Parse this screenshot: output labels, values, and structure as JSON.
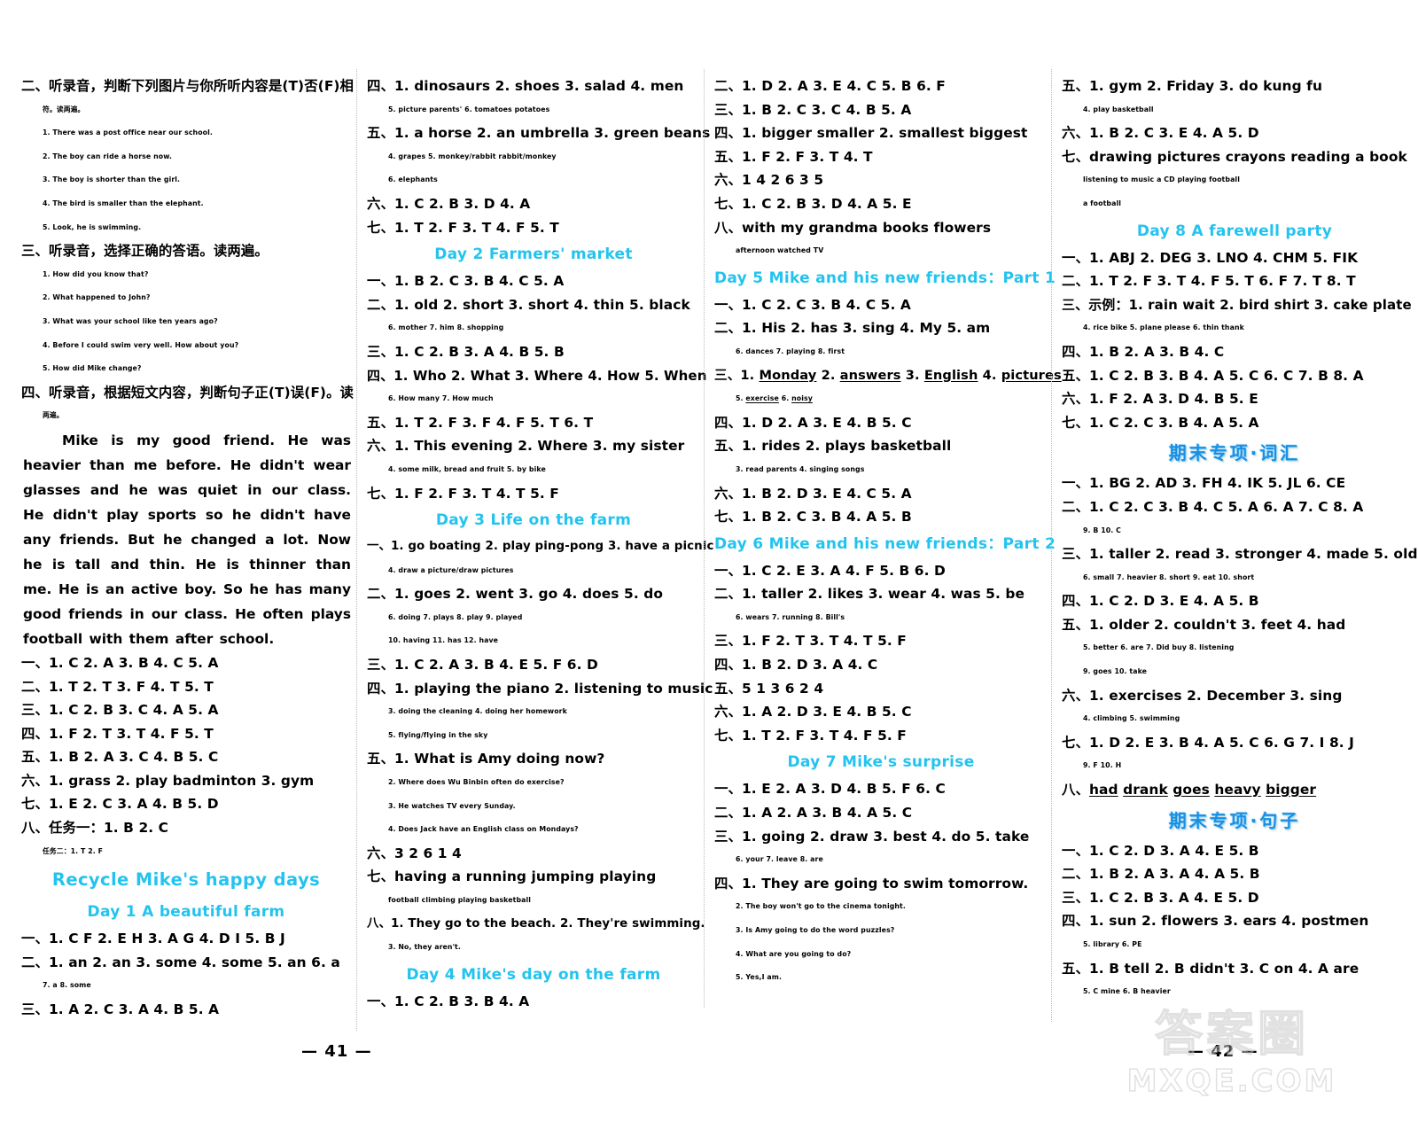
{
  "document": {
    "page_numbers": {
      "left": "— 41 —",
      "right": "— 42 —"
    },
    "watermark": {
      "chinese": "答案圈",
      "english": "MXQE.COM"
    }
  },
  "column1": {
    "blocks": [
      {
        "type": "line",
        "text": "二、听录音，判断下列图片与你所听内容是(T)否(F)相"
      },
      {
        "type": "line",
        "indent": 1,
        "text": "符。读两遍。"
      },
      {
        "type": "line",
        "indent": 1,
        "text": "1. There was a post office near our school."
      },
      {
        "type": "line",
        "indent": 1,
        "text": "2. The boy can ride a horse now."
      },
      {
        "type": "line",
        "indent": 1,
        "text": "3. The boy is shorter than the girl."
      },
      {
        "type": "line",
        "indent": 1,
        "text": "4. The bird is smaller than the elephant."
      },
      {
        "type": "line",
        "indent": 1,
        "text": "5. Look, he is swimming."
      },
      {
        "type": "line",
        "text": "三、听录音，选择正确的答语。读两遍。"
      },
      {
        "type": "line",
        "indent": 1,
        "text": "1. How did you know that?"
      },
      {
        "type": "line",
        "indent": 1,
        "text": "2. What happened to John?"
      },
      {
        "type": "line",
        "indent": 1,
        "text": "3. What was your school like ten years ago?"
      },
      {
        "type": "line",
        "indent": 1,
        "text": "4. Before I could swim very well. How about you?"
      },
      {
        "type": "line",
        "indent": 1,
        "text": "5. How did Mike change?"
      },
      {
        "type": "line",
        "text": "四、听录音，根据短文内容，判断句子正(T)误(F)。读"
      },
      {
        "type": "line",
        "indent": 1,
        "text": "两遍。"
      },
      {
        "type": "para",
        "text": "Mike is my good friend. He was heavier than me before. He didn't wear glasses and he was quiet in our class. He didn't play sports so he didn't have any friends. But he changed a lot. Now he is tall and thin. He is thinner than me. He is an active boy. So he has many good friends in our class. He often plays football with them after school."
      },
      {
        "type": "line",
        "text": "一、1. C   2. A   3. B   4. C   5. A"
      },
      {
        "type": "line",
        "text": "二、1. T   2. T   3. F   4. T   5. T"
      },
      {
        "type": "line",
        "text": "三、1. C   2. B   3. C   4. A   5. A"
      },
      {
        "type": "line",
        "text": "四、1. F   2. T   3. T   4. F   5. T"
      },
      {
        "type": "line",
        "text": "五、1. B   2. A   3. C   4. B   5. C"
      },
      {
        "type": "line",
        "text": "六、1. grass   2. play  badminton   3. gym"
      },
      {
        "type": "line",
        "text": "七、1. E   2. C   3. A   4. B   5. D"
      },
      {
        "type": "line",
        "text": "八、任务一：1. B   2. C"
      },
      {
        "type": "line",
        "indent": 1,
        "text": "任务二：1. T   2. F"
      },
      {
        "type": "recycle",
        "text": "Recycle   Mike's happy days"
      },
      {
        "type": "day",
        "text": "Day 1   A beautiful farm"
      },
      {
        "type": "line",
        "text": "一、1. C  F  2. E  H  3. A  G  4. D  I  5. B  J"
      },
      {
        "type": "line",
        "text": "二、1. an  2. an  3. some  4. some  5. an  6. a"
      },
      {
        "type": "line",
        "indent": 1,
        "text": "7. a   8. some"
      },
      {
        "type": "line",
        "text": "三、1. A   2. C   3. A   4. B   5. A"
      }
    ]
  },
  "column2": {
    "blocks": [
      {
        "type": "line",
        "text": "四、1. dinosaurs   2. shoes   3. salad   4. men"
      },
      {
        "type": "line",
        "indent": 1,
        "text": "5. picture  parents'   6. tomatoes  potatoes"
      },
      {
        "type": "line",
        "text": "五、1. a  horse  2. an  umbrella  3. green  beans"
      },
      {
        "type": "line",
        "indent": 1,
        "text": "4. grapes   5. monkey/rabbit   rabbit/monkey"
      },
      {
        "type": "line",
        "indent": 1,
        "text": "6. elephants"
      },
      {
        "type": "line",
        "text": "六、1. C   2. B   3. D   4. A"
      },
      {
        "type": "line",
        "text": "七、1. T   2. F   3. T   4. F   5. T"
      },
      {
        "type": "day",
        "text": "Day 2   Farmers' market"
      },
      {
        "type": "line",
        "text": "一、1. B   2. C   3. B   4. C   5. A"
      },
      {
        "type": "line",
        "text": "二、1. old   2. short   3. short   4. thin   5. black"
      },
      {
        "type": "line",
        "indent": 1,
        "text": "6. mother   7. him   8. shopping"
      },
      {
        "type": "line",
        "text": "三、1. C   2. B   3. A   4. B   5. B"
      },
      {
        "type": "line",
        "text": "四、1. Who   2. What   3. Where   4. How   5. When"
      },
      {
        "type": "line",
        "indent": 1,
        "text": "6. How many   7. How much"
      },
      {
        "type": "line",
        "text": "五、1. T   2. F   3. F   4. F   5. T   6. T"
      },
      {
        "type": "line",
        "text": "六、1. This evening   2. Where   3. my sister"
      },
      {
        "type": "line",
        "indent": 1,
        "text": "4. some milk, bread and fruit   5. by bike"
      },
      {
        "type": "line",
        "text": "七、1. F   2. F   3. T   4. T   5. F"
      },
      {
        "type": "day",
        "text": "Day 3   Life on the farm"
      },
      {
        "type": "line",
        "text": "一、1. go boating   2. play ping-pong   3. have a picnic"
      },
      {
        "type": "line",
        "indent": 1,
        "text": "4. draw a picture/draw pictures"
      },
      {
        "type": "line",
        "text": "二、1. goes   2. went   3. go   4. does   5. do"
      },
      {
        "type": "line",
        "indent": 1,
        "text": "6. doing   7. plays   8. play   9. played"
      },
      {
        "type": "line",
        "indent": 1,
        "text": "10. having   11. has   12. have"
      },
      {
        "type": "line",
        "text": "三、1. C   2. A   3. B   4. E   5. F   6. D"
      },
      {
        "type": "line",
        "text": "四、1. playing the piano   2. listening to music"
      },
      {
        "type": "line",
        "indent": 1,
        "text": "3. doing the cleaning   4. doing her homework"
      },
      {
        "type": "line",
        "indent": 1,
        "text": "5. flying/flying in the sky"
      },
      {
        "type": "line",
        "text": "五、1. What is Amy doing now?"
      },
      {
        "type": "line",
        "indent": 1,
        "text": "2. Where does Wu Binbin often do exercise?"
      },
      {
        "type": "line",
        "indent": 1,
        "text": "3. He watches TV every Sunday."
      },
      {
        "type": "line",
        "indent": 1,
        "text": "4. Does Jack have an English class on Mondays?"
      },
      {
        "type": "line",
        "text": "六、3  2  6  1  4"
      },
      {
        "type": "line",
        "text": "七、having   a   running   jumping   playing"
      },
      {
        "type": "line",
        "indent": 1,
        "text": "football   climbing   playing   basketball"
      },
      {
        "type": "line",
        "text": "八、1. They go to the beach.   2. They're swimming."
      },
      {
        "type": "line",
        "indent": 1,
        "text": "3. No, they aren't."
      },
      {
        "type": "day",
        "text": "Day 4   Mike's day on the farm"
      },
      {
        "type": "line",
        "text": "一、1. C   2. B   3. B   4. A"
      }
    ]
  },
  "column3": {
    "blocks": [
      {
        "type": "line",
        "text": "二、1. D   2. A   3. E   4. C   5. B   6. F"
      },
      {
        "type": "line",
        "text": "三、1. B   2. C   3. C   4. B   5. A"
      },
      {
        "type": "line",
        "text": "四、1. bigger  smaller   2. smallest  biggest"
      },
      {
        "type": "line",
        "text": "五、1. F   2. F   3. T   4. T"
      },
      {
        "type": "line",
        "text": "六、1  4  2  6  3  5"
      },
      {
        "type": "line",
        "text": "七、1. C   2. B   3. D   4. A   5. E"
      },
      {
        "type": "line",
        "text": "八、with   my   grandma   books   flowers"
      },
      {
        "type": "line",
        "indent": 1,
        "text": "afternoon   watched   TV"
      },
      {
        "type": "day",
        "text": "Day 5   Mike and his new friends：Part 1"
      },
      {
        "type": "line",
        "text": "一、1. C   2. C   3. B   4. C   5. A"
      },
      {
        "type": "line",
        "text": "二、1. His   2. has   3. sing   4. My   5. am"
      },
      {
        "type": "line",
        "indent": 1,
        "text": "6. dances   7. playing   8. first"
      },
      {
        "type": "line_u",
        "lead": "三、",
        "items": [
          "1. Monday",
          "2. answers",
          "3. English",
          "4. pictures"
        ]
      },
      {
        "type": "line_u",
        "lead": "",
        "indent": 1,
        "items": [
          "5. exercise",
          "6. noisy"
        ]
      },
      {
        "type": "line",
        "text": "四、1. D   2. A   3. E   4. B   5. C"
      },
      {
        "type": "line",
        "text": "五、1. rides   2. plays   basketball"
      },
      {
        "type": "line",
        "indent": 1,
        "text": "3. read   parents   4. singing   songs"
      },
      {
        "type": "line",
        "text": "六、1. B   2. D   3. E   4. C   5. A"
      },
      {
        "type": "line",
        "text": "七、1. B   2. C   3. B   4. A   5. B"
      },
      {
        "type": "day",
        "text": "Day 6   Mike and his new friends：Part 2"
      },
      {
        "type": "line",
        "text": "一、1. C   2. E   3. A   4. F   5. B   6. D"
      },
      {
        "type": "line",
        "text": "二、1. taller   2. likes   3. wear   4. was   5. be"
      },
      {
        "type": "line",
        "indent": 1,
        "text": "6. wears   7. running   8. Bill's"
      },
      {
        "type": "line",
        "text": "三、1. F   2. T   3. T   4. T   5. F"
      },
      {
        "type": "line",
        "text": "四、1. B   2. D   3. A   4. C"
      },
      {
        "type": "line",
        "text": "五、5  1  3  6  2  4"
      },
      {
        "type": "line",
        "text": "六、1. A   2. D   3. E   4. B   5. C"
      },
      {
        "type": "line",
        "text": "七、1. T   2. F   3. T   4. F   5. F"
      },
      {
        "type": "day",
        "text": "Day 7   Mike's surprise"
      },
      {
        "type": "line",
        "text": "一、1. E   2. A   3. D   4. B   5. F   6. C"
      },
      {
        "type": "line",
        "text": "二、1. A   2. A   3. B   4. A   5. C"
      },
      {
        "type": "line",
        "text": "三、1. going   2. draw   3. best   4. do   5. take"
      },
      {
        "type": "line",
        "indent": 1,
        "text": "6. your   7. leave   8. are"
      },
      {
        "type": "line",
        "text": "四、1. They are going to swim tomorrow."
      },
      {
        "type": "line",
        "indent": 1,
        "text": "2. The boy won't go to the cinema tonight."
      },
      {
        "type": "line",
        "indent": 1,
        "text": "3. Is Amy going to do the word puzzles?"
      },
      {
        "type": "line",
        "indent": 1,
        "text": "4. What are you going to do?"
      },
      {
        "type": "line",
        "indent": 1,
        "text": "5. Yes,I am."
      }
    ]
  },
  "column4": {
    "blocks": [
      {
        "type": "line",
        "text": "五、1. gym   2. Friday   3. do kung fu"
      },
      {
        "type": "line",
        "indent": 1,
        "text": "4. play basketball"
      },
      {
        "type": "line",
        "text": "六、1. B   2. C   3. E   4. A   5. D"
      },
      {
        "type": "line",
        "text": "七、drawing pictures   crayons   reading   a book"
      },
      {
        "type": "line",
        "indent": 1,
        "text": "listening to music   a CD   playing football"
      },
      {
        "type": "line",
        "indent": 1,
        "text": "a football"
      },
      {
        "type": "day",
        "text": "Day 8   A farewell party"
      },
      {
        "type": "line",
        "text": "一、1. ABJ   2. DEG   3. LNO   4. CHM   5. FIK"
      },
      {
        "type": "line",
        "text": "二、1. T   2. F   3. T   4. F   5. T   6. F   7. T   8. T"
      },
      {
        "type": "line",
        "text": "三、示例：1. rain   wait   2. bird   shirt   3. cake   plate"
      },
      {
        "type": "line",
        "indent": 1,
        "text": "4. rice   bike   5. plane   please   6. thin   thank"
      },
      {
        "type": "line",
        "text": "四、1. B   2. A   3. B   4. C"
      },
      {
        "type": "line",
        "text": "五、1. C   2. B   3. B   4. A   5. C   6. C   7. B   8. A"
      },
      {
        "type": "line",
        "text": "六、1. F   2. A   3. D   4. B   5. E"
      },
      {
        "type": "line",
        "text": "七、1. C   2. C   3. B   4. A   5. A"
      },
      {
        "type": "section",
        "text": "期末专项·词汇"
      },
      {
        "type": "line",
        "text": "一、1. BG   2. AD   3. FH   4. IK   5. JL   6. CE"
      },
      {
        "type": "line",
        "text": "二、1. C   2. C   3. B   4. C   5. A   6. A   7. C   8. A"
      },
      {
        "type": "line",
        "indent": 1,
        "text": "9. B   10. C"
      },
      {
        "type": "line",
        "text": "三、1. taller   2. read   3. stronger   4. made   5. old"
      },
      {
        "type": "line",
        "indent": 1,
        "text": "6. small   7. heavier   8. short   9. eat   10. short"
      },
      {
        "type": "line",
        "text": "四、1. C   2. D   3. E   4. A   5. B"
      },
      {
        "type": "line",
        "text": "五、1. older   2. couldn't   3. feet   4. had"
      },
      {
        "type": "line",
        "indent": 1,
        "text": "5. better   6. are   7. Did   buy   8. listening"
      },
      {
        "type": "line",
        "indent": 1,
        "text": "9. goes   10. take"
      },
      {
        "type": "line",
        "text": "六、1. exercises   2. December   3. sing"
      },
      {
        "type": "line",
        "indent": 1,
        "text": "4. climbing   5. swimming"
      },
      {
        "type": "line",
        "text": "七、1. D   2. E   3. B   4. A   5. C   6. G   7. I   8. J"
      },
      {
        "type": "line",
        "indent": 1,
        "text": "9. F   10. H"
      },
      {
        "type": "line_u",
        "lead": "八、",
        "items": [
          "had",
          "drank",
          "goes",
          "heavy",
          "bigger"
        ]
      },
      {
        "type": "section",
        "text": "期末专项·句子"
      },
      {
        "type": "line",
        "text": "一、1. C   2. D   3. A   4. E   5. B"
      },
      {
        "type": "line",
        "text": "二、1. B   2. A   3. A   4. A   5. B"
      },
      {
        "type": "line",
        "text": "三、1. C   2. B   3. A   4. E   5. D"
      },
      {
        "type": "line",
        "text": "四、1. sun   2. flowers   3. ears   4. postmen"
      },
      {
        "type": "line",
        "indent": 1,
        "text": "5. library   6. PE"
      },
      {
        "type": "line",
        "text": "五、1. B   tell   2. B   didn't   3. C   on   4. A   are"
      },
      {
        "type": "line",
        "indent": 1,
        "text": "5. C   mine   6. B   heavier"
      }
    ]
  }
}
